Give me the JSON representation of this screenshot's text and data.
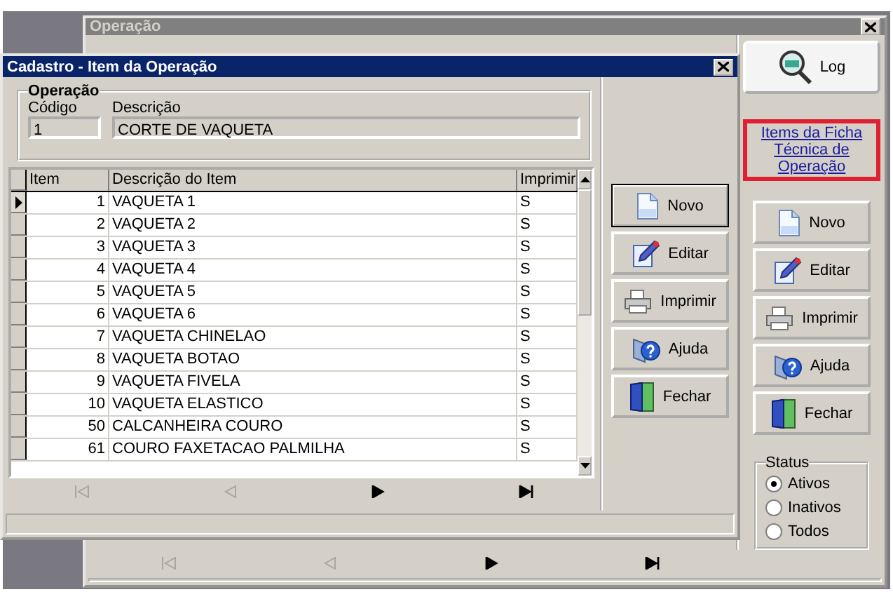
{
  "back_window": {
    "title": "Operação",
    "log_button": {
      "kind": "log",
      "label": "Log"
    },
    "link": {
      "text": "Items da Ficha Técnica de Operação",
      "highlighted": true
    },
    "buttons": [
      {
        "kind": "new",
        "label": "Novo",
        "default": false
      },
      {
        "kind": "edit",
        "label": "Editar",
        "default": false
      },
      {
        "kind": "print",
        "label": "Imprimir",
        "default": false
      },
      {
        "kind": "help",
        "label": "Ajuda",
        "default": false
      },
      {
        "kind": "close",
        "label": "Fechar",
        "default": false
      }
    ],
    "status_group": {
      "title": "Status",
      "options": [
        {
          "label": "Ativos",
          "selected": true
        },
        {
          "label": "Inativos",
          "selected": false
        },
        {
          "label": "Todos",
          "selected": false
        }
      ]
    },
    "navigator": [
      {
        "kind": "first",
        "disabled": true
      },
      {
        "kind": "prev",
        "disabled": true
      },
      {
        "kind": "next",
        "disabled": false
      },
      {
        "kind": "last",
        "disabled": false
      }
    ]
  },
  "dialog": {
    "title": "Cadastro - Item da Operação",
    "group": {
      "title": "Operação",
      "fields": [
        {
          "label": "Código",
          "value": "1"
        },
        {
          "label": "Descrição",
          "value": "CORTE DE VAQUETA"
        }
      ]
    },
    "grid": {
      "columns": [
        "Item",
        "Descrição do Item",
        "Imprimir"
      ],
      "rows": [
        {
          "item": "1",
          "description": "VAQUETA 1",
          "print": "S",
          "selected": true
        },
        {
          "item": "2",
          "description": "VAQUETA 2",
          "print": "S",
          "selected": false
        },
        {
          "item": "3",
          "description": "VAQUETA 3",
          "print": "S",
          "selected": false
        },
        {
          "item": "4",
          "description": "VAQUETA 4",
          "print": "S",
          "selected": false
        },
        {
          "item": "5",
          "description": "VAQUETA 5",
          "print": "S",
          "selected": false
        },
        {
          "item": "6",
          "description": "VAQUETA 6",
          "print": "S",
          "selected": false
        },
        {
          "item": "7",
          "description": "VAQUETA CHINELAO",
          "print": "S",
          "selected": false
        },
        {
          "item": "8",
          "description": "VAQUETA BOTAO",
          "print": "S",
          "selected": false
        },
        {
          "item": "9",
          "description": "VAQUETA FIVELA",
          "print": "S",
          "selected": false
        },
        {
          "item": "10",
          "description": "VAQUETA ELASTICO",
          "print": "S",
          "selected": false
        },
        {
          "item": "50",
          "description": "CALCANHEIRA COURO",
          "print": "S",
          "selected": false
        },
        {
          "item": "61",
          "description": "COURO FAXETACAO PALMILHA",
          "print": "S",
          "selected": false
        }
      ]
    },
    "navigator": [
      {
        "kind": "first",
        "disabled": true
      },
      {
        "kind": "prev",
        "disabled": true
      },
      {
        "kind": "next",
        "disabled": false
      },
      {
        "kind": "last",
        "disabled": false
      }
    ],
    "buttons": [
      {
        "kind": "new",
        "label": "Novo",
        "default": true
      },
      {
        "kind": "edit",
        "label": "Editar",
        "default": false
      },
      {
        "kind": "print",
        "label": "Imprimir",
        "default": false
      },
      {
        "kind": "help",
        "label": "Ajuda",
        "default": false
      },
      {
        "kind": "close",
        "label": "Fechar",
        "default": false
      }
    ]
  }
}
